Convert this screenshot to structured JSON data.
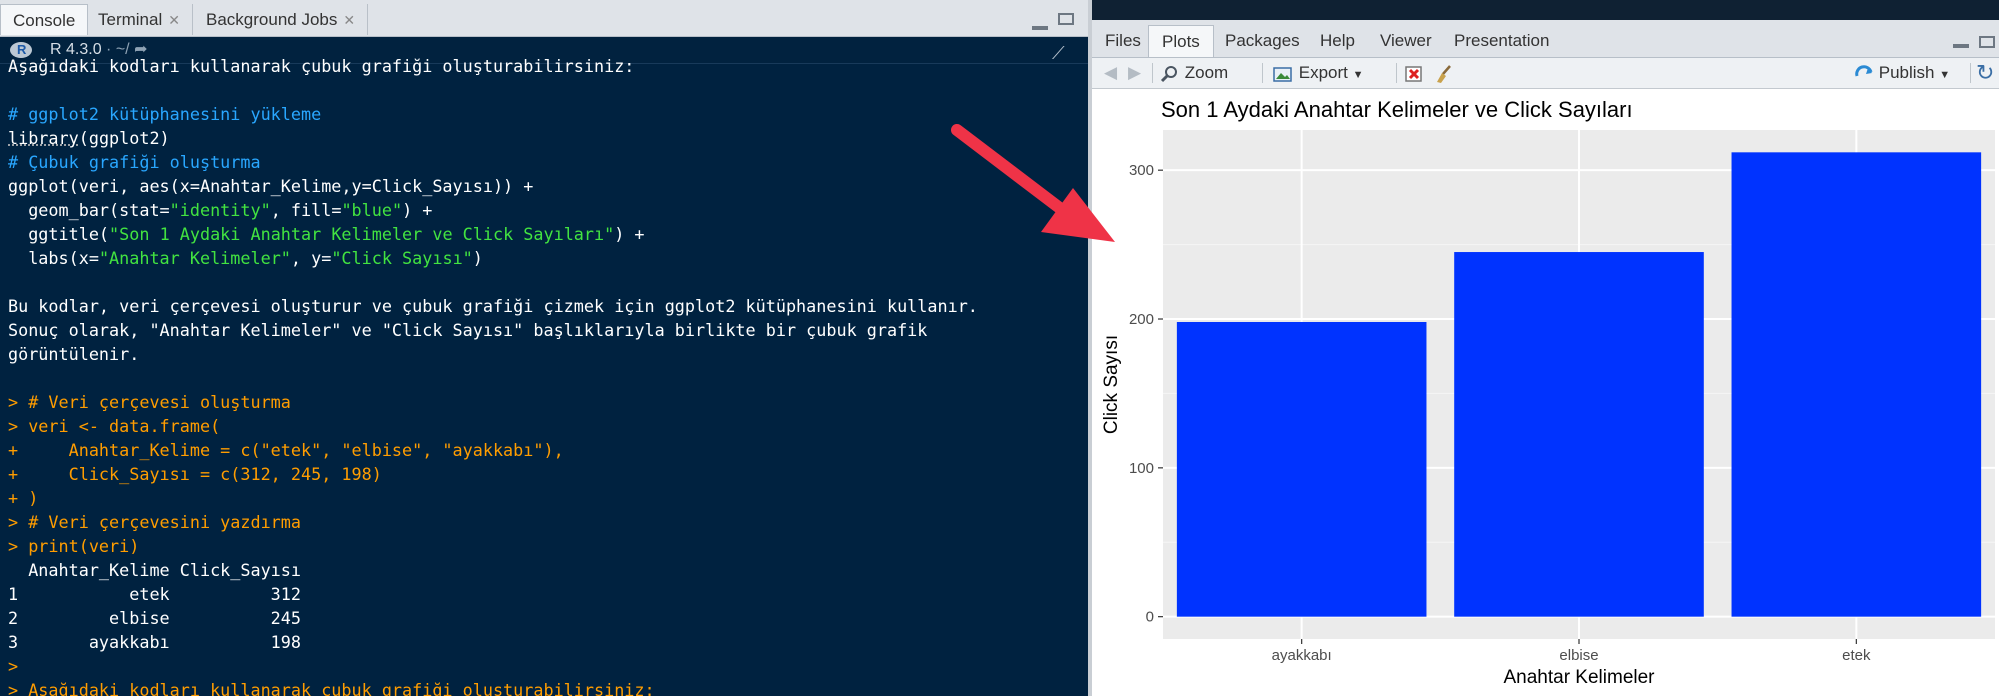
{
  "console_pane": {
    "tabs": [
      {
        "label": "Console",
        "active": true,
        "closable": false
      },
      {
        "label": "Terminal",
        "active": false,
        "closable": true
      },
      {
        "label": "Background Jobs",
        "active": false,
        "closable": true
      }
    ],
    "r_version": "R 4.3.0",
    "path": "· ~/",
    "lines": [
      [
        {
          "t": "Aşağıdaki kodları kullanarak çubuk grafiği oluşturabilirsiniz:",
          "c": "wht"
        }
      ],
      [
        {
          "t": "",
          "c": "wht"
        }
      ],
      [
        {
          "t": "# ggplot2 kütüphanesini yükleme",
          "c": "com"
        }
      ],
      [
        {
          "t": "library",
          "c": "wht",
          "u": true
        },
        {
          "t": "(ggplot2)",
          "c": "wht"
        }
      ],
      [
        {
          "t": "# Çubuk grafiği oluşturma",
          "c": "com"
        }
      ],
      [
        {
          "t": "ggplot(veri, aes(x=Anahtar_Kelime,y=Click_Sayısı)) +",
          "c": "wht"
        }
      ],
      [
        {
          "t": "  geom_bar(stat=",
          "c": "wht"
        },
        {
          "t": "\"identity\"",
          "c": "str"
        },
        {
          "t": ", fill=",
          "c": "wht"
        },
        {
          "t": "\"blue\"",
          "c": "str"
        },
        {
          "t": ") +",
          "c": "wht"
        }
      ],
      [
        {
          "t": "  ggtitle(",
          "c": "wht"
        },
        {
          "t": "\"Son 1 Aydaki Anahtar Kelimeler ve Click Sayıları\"",
          "c": "str"
        },
        {
          "t": ") +",
          "c": "wht"
        }
      ],
      [
        {
          "t": "  labs(x=",
          "c": "wht"
        },
        {
          "t": "\"Anahtar Kelimeler\"",
          "c": "str"
        },
        {
          "t": ", y=",
          "c": "wht"
        },
        {
          "t": "\"Click Sayısı\"",
          "c": "str"
        },
        {
          "t": ")",
          "c": "wht"
        }
      ],
      [
        {
          "t": "",
          "c": "wht"
        }
      ],
      [
        {
          "t": "Bu kodlar, veri çerçevesi oluşturur ve çubuk grafiği çizmek için ggplot2 kütüphanesini kullanır.",
          "c": "wht"
        }
      ],
      [
        {
          "t": "Sonuç olarak, \"Anahtar Kelimeler\" ve \"Click Sayısı\" başlıklarıyla birlikte bir çubuk grafik",
          "c": "wht"
        }
      ],
      [
        {
          "t": "görüntülenir.",
          "c": "wht"
        }
      ],
      [
        {
          "t": "",
          "c": "wht"
        }
      ],
      [
        {
          "t": "> # Veri çerçevesi oluşturma",
          "c": "org"
        }
      ],
      [
        {
          "t": "> veri <- data.frame(",
          "c": "org"
        }
      ],
      [
        {
          "t": "+     Anahtar_Kelime = c(\"etek\", \"elbise\", \"ayakkabı\"),",
          "c": "org"
        }
      ],
      [
        {
          "t": "+     Click_Sayısı = c(312, 245, 198)",
          "c": "org"
        }
      ],
      [
        {
          "t": "+ )",
          "c": "org"
        }
      ],
      [
        {
          "t": "> # Veri çerçevesini yazdırma",
          "c": "org"
        }
      ],
      [
        {
          "t": "> print(veri)",
          "c": "org"
        }
      ],
      [
        {
          "t": "  Anahtar_Kelime Click_Sayısı",
          "c": "wht"
        }
      ],
      [
        {
          "t": "1           etek          312",
          "c": "wht"
        }
      ],
      [
        {
          "t": "2         elbise          245",
          "c": "wht"
        }
      ],
      [
        {
          "t": "3       ayakkabı          198",
          "c": "wht"
        }
      ],
      [
        {
          "t": ">",
          "c": "org"
        }
      ],
      [
        {
          "t": "> Aşağıdaki kodları kullanarak çubuk grafiği oluşturabilirsiniz:",
          "c": "org"
        }
      ]
    ]
  },
  "plots_pane": {
    "tabs": [
      {
        "label": "Files",
        "active": false
      },
      {
        "label": "Plots",
        "active": true
      },
      {
        "label": "Packages",
        "active": false
      },
      {
        "label": "Help",
        "active": false
      },
      {
        "label": "Viewer",
        "active": false
      },
      {
        "label": "Presentation",
        "active": false
      }
    ],
    "toolbar": {
      "zoom": "Zoom",
      "export": "Export",
      "publish": "Publish"
    }
  },
  "colors": {
    "console_bg": "#002240",
    "bar_fill": "#0033ff",
    "panel_bg": "#ebebeb",
    "arrow": "#ef3347"
  },
  "chart_data": {
    "type": "bar",
    "title": "Son 1 Aydaki Anahtar Kelimeler ve Click Sayıları",
    "xlabel": "Anahtar Kelimeler",
    "ylabel": "Click Sayısı",
    "categories": [
      "ayakkabı",
      "elbise",
      "etek"
    ],
    "values": [
      198,
      245,
      312
    ],
    "yticks": [
      0,
      100,
      200,
      300
    ],
    "ylim": [
      -15,
      327
    ],
    "grid": true,
    "legend": "none"
  }
}
